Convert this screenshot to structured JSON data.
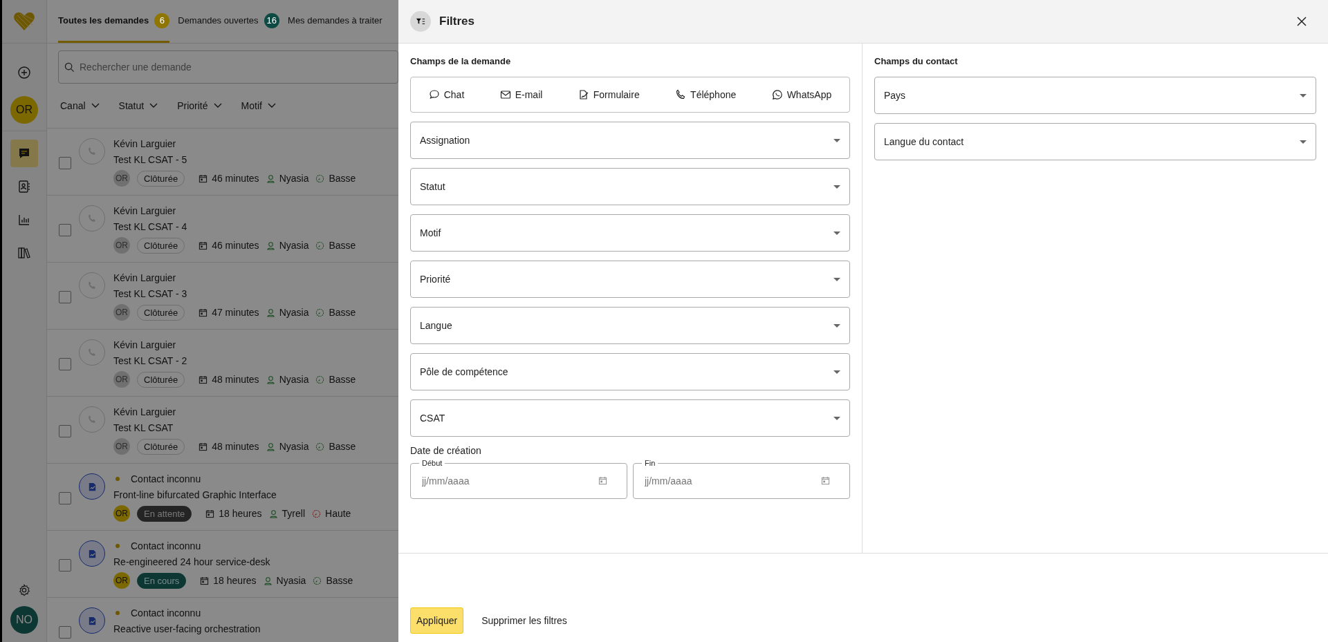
{
  "sidebar": {
    "nav": [
      {
        "selected": false
      },
      {
        "selected": true
      },
      {
        "selected": false
      },
      {
        "selected": false
      },
      {
        "selected": false
      }
    ],
    "user_initials": "OR",
    "account_initials": "NO"
  },
  "tabs": [
    {
      "label": "Toutes les demandes",
      "count": "6",
      "color": "#8f7600",
      "selected": true
    },
    {
      "label": "Demandes ouvertes",
      "count": "16",
      "color": "#0e4a44",
      "selected": false
    },
    {
      "label": "Mes demandes à traiter",
      "selected": false
    }
  ],
  "search": {
    "placeholder": "Rechercher une demande"
  },
  "quick_filters": [
    "Canal",
    "Statut",
    "Priorité",
    "Motif"
  ],
  "requests": [
    {
      "kind": "phone",
      "checked": false,
      "unread": false,
      "contact": "Kévin Larguier",
      "subject": "Test KL CSAT - 5",
      "assignee_initials": "OR",
      "assignee_active": false,
      "status": {
        "label": "Clôturée",
        "kind": "closed"
      },
      "age": "46 minutes",
      "agent": "Nyasia",
      "priority": {
        "label": "Basse",
        "kind": "low"
      }
    },
    {
      "kind": "phone",
      "checked": false,
      "unread": false,
      "contact": "Kévin Larguier",
      "subject": "Test KL CSAT - 4",
      "assignee_initials": "OR",
      "assignee_active": false,
      "status": {
        "label": "Clôturée",
        "kind": "closed"
      },
      "age": "46 minutes",
      "agent": "Nyasia",
      "priority": {
        "label": "Basse",
        "kind": "low"
      }
    },
    {
      "kind": "phone",
      "checked": false,
      "unread": false,
      "contact": "Kévin Larguier",
      "subject": "Test KL CSAT - 3",
      "assignee_initials": "OR",
      "assignee_active": false,
      "status": {
        "label": "Clôturée",
        "kind": "closed"
      },
      "age": "47 minutes",
      "agent": "Nyasia",
      "priority": {
        "label": "Basse",
        "kind": "low"
      }
    },
    {
      "kind": "phone",
      "checked": false,
      "unread": false,
      "contact": "Kévin Larguier",
      "subject": "Test KL CSAT - 2",
      "assignee_initials": "OR",
      "assignee_active": false,
      "status": {
        "label": "Clôturée",
        "kind": "closed"
      },
      "age": "48 minutes",
      "agent": "Nyasia",
      "priority": {
        "label": "Basse",
        "kind": "low"
      }
    },
    {
      "kind": "phone",
      "checked": false,
      "unread": false,
      "contact": "Kévin Larguier",
      "subject": "Test KL CSAT",
      "assignee_initials": "OR",
      "assignee_active": false,
      "status": {
        "label": "Clôturée",
        "kind": "closed"
      },
      "age": "48 minutes",
      "agent": "Nyasia",
      "priority": {
        "label": "Basse",
        "kind": "low"
      }
    },
    {
      "kind": "form",
      "checked": false,
      "unread": true,
      "contact": "Contact inconnu",
      "subject": "Front-line bifurcated Graphic Interface",
      "assignee_initials": "OR",
      "assignee_active": true,
      "status": {
        "label": "En attente",
        "kind": "waiting"
      },
      "age": "18 heures",
      "agent": "Tyrell",
      "priority": {
        "label": "Haute",
        "kind": "high"
      }
    },
    {
      "kind": "form",
      "checked": false,
      "unread": true,
      "contact": "Contact inconnu",
      "subject": "Re-engineered 24 hour service-desk",
      "assignee_initials": "OR",
      "assignee_active": true,
      "status": {
        "label": "En cours",
        "kind": "in_progress"
      },
      "age": "18 heures",
      "agent": "Nyasia",
      "priority": {
        "label": "Basse",
        "kind": "low"
      }
    },
    {
      "kind": "form",
      "checked": false,
      "unread": true,
      "contact": "Contact inconnu",
      "subject": "Reactive user-facing orchestration"
    }
  ],
  "filters_panel": {
    "title": "Filtres",
    "request_fields": {
      "heading": "Champs de la demande",
      "channels": [
        "Chat",
        "E-mail",
        "Formulaire",
        "Téléphone",
        "WhatsApp"
      ],
      "selects": [
        "Assignation",
        "Statut",
        "Motif",
        "Priorité",
        "Langue",
        "Pôle de compétence",
        "CSAT"
      ],
      "date_label": "Date de création",
      "dates": [
        {
          "label": "Début",
          "placeholder": "jj/mm/aaaa"
        },
        {
          "label": "Fin",
          "placeholder": "jj/mm/aaaa"
        }
      ]
    },
    "contact_fields": {
      "heading": "Champs du contact",
      "selects": [
        "Pays",
        "Langue du contact"
      ]
    },
    "apply_button": "Appliquer",
    "clear_button": "Supprimer les filtres"
  }
}
